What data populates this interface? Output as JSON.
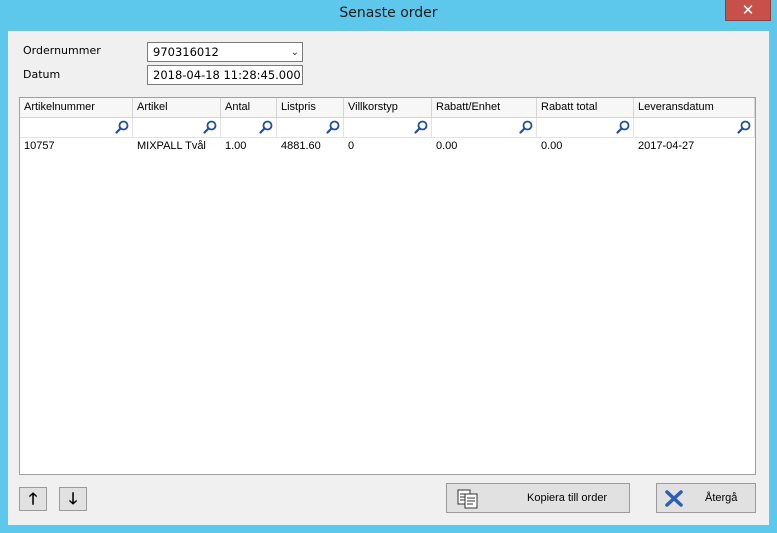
{
  "window": {
    "title": "Senaste order",
    "close_label": "✕"
  },
  "form": {
    "order_label": "Ordernummer",
    "order_value": "970316012",
    "date_label": "Datum",
    "date_value": "2018-04-18 11:28:45.000"
  },
  "grid": {
    "columns": [
      "Artikelnummer",
      "Artikel",
      "Antal",
      "Listpris",
      "Villkorstyp",
      "Rabatt/Enhet",
      "Rabatt total",
      "Leveransdatum"
    ],
    "rows": [
      [
        "10757",
        "MIXPALL Tvål",
        "1.00",
        "4881.60",
        "0",
        "0.00",
        "0.00",
        "2017-04-27"
      ]
    ]
  },
  "buttons": {
    "up": "🡑",
    "down": "🡓",
    "copy": "Kopiera till order",
    "back": "Återgå"
  },
  "colors": {
    "titlebar": "#5ec8ec",
    "close": "#c7504a",
    "search_icon": "#1f4fa0",
    "back_icon": "#2b5fb5"
  }
}
